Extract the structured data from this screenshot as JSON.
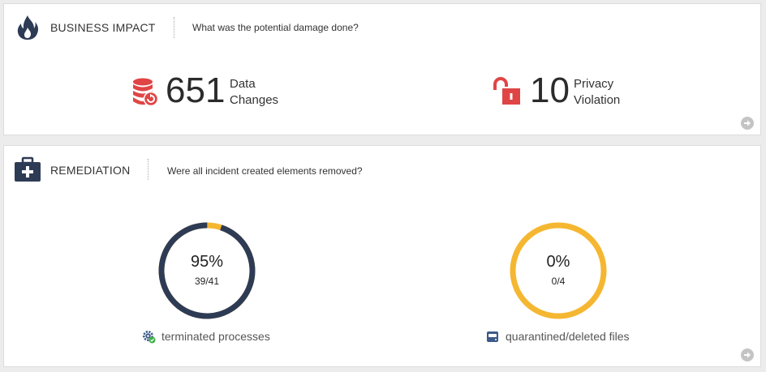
{
  "business_impact": {
    "title": "BUSINESS IMPACT",
    "question": "What was the potential damage done?",
    "stats": [
      {
        "icon": "database-restore-icon",
        "value": "651",
        "label_line1": "Data",
        "label_line2": "Changes",
        "color": "#e04545"
      },
      {
        "icon": "unlocked-padlock-icon",
        "value": "10",
        "label_line1": "Privacy",
        "label_line2": "Violation",
        "color": "#e04545"
      }
    ]
  },
  "remediation": {
    "title": "REMEDIATION",
    "question": "Were all incident created elements removed?",
    "metrics": [
      {
        "percent_text": "95%",
        "fraction_text": "39/41",
        "fraction": 0.95,
        "caption": "terminated processes",
        "icon": "gear-check-icon"
      },
      {
        "percent_text": "0%",
        "fraction_text": "0/4",
        "fraction": 0.0,
        "caption": "quarantined/deleted files",
        "icon": "quarantine-drive-icon"
      }
    ]
  },
  "colors": {
    "dark_navy": "#2e3b55",
    "accent_yellow": "#f5b731",
    "alert_red": "#e04545",
    "more_button_gray": "#c4c4c4"
  }
}
